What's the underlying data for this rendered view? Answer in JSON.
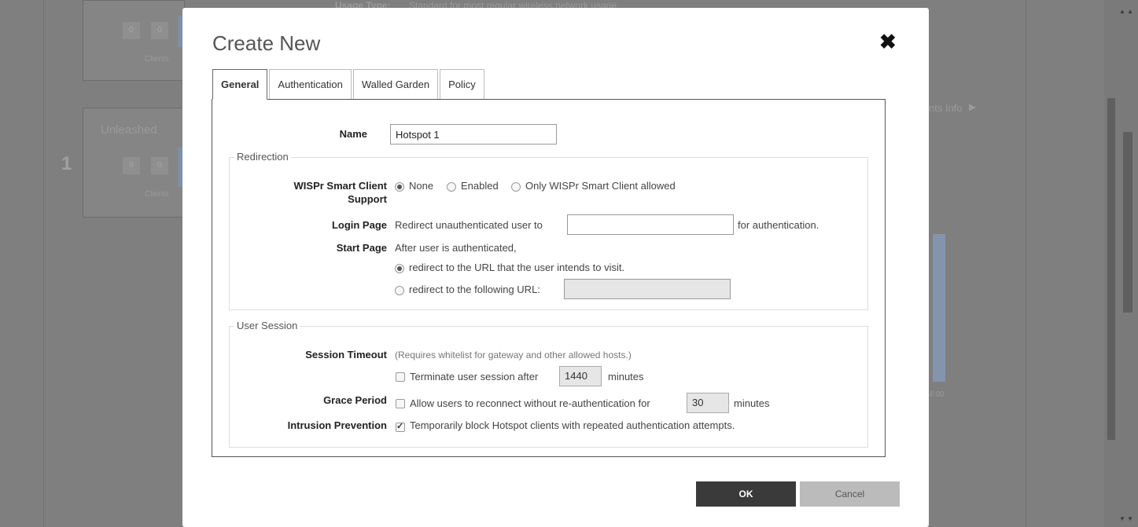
{
  "background": {
    "usage_type_label": "Usage Type:",
    "usage_type_value": "Standard for most regular wireless network usage",
    "card1": {
      "zero1": "0",
      "zero2": "0",
      "clients_label": "Clients"
    },
    "card2": {
      "title": "Unleashed",
      "count": "1",
      "zero1": "0",
      "zero2": "0",
      "clients_label": "Clients"
    },
    "clients_info_link": "nts Info",
    "chart_tick": "4:00"
  },
  "modal": {
    "title": "Create New",
    "close_icon": "close-icon",
    "tabs": [
      {
        "label": "General",
        "active": true
      },
      {
        "label": "Authentication",
        "active": false
      },
      {
        "label": "Walled Garden",
        "active": false
      },
      {
        "label": "Policy",
        "active": false
      }
    ],
    "general": {
      "name_label": "Name",
      "name_value": "Hotspot 1",
      "redirection": {
        "legend": "Redirection",
        "wispr_label_line1": "WISPr Smart Client",
        "wispr_label_line2": "Support",
        "wispr_options": [
          {
            "label": "None",
            "checked": true
          },
          {
            "label": "Enabled",
            "checked": false
          },
          {
            "label": "Only WISPr Smart Client allowed",
            "checked": false
          }
        ],
        "login_page_label": "Login Page",
        "login_page_prefix": "Redirect unauthenticated user to",
        "login_page_value": "",
        "login_page_suffix": "for authentication.",
        "start_page_label": "Start Page",
        "start_page_text": "After user is authenticated,",
        "start_option_intended": "redirect to the URL that the user intends to visit.",
        "start_option_following": "redirect to the following URL:",
        "start_option_intended_checked": true,
        "start_url_value": ""
      },
      "user_session": {
        "legend": "User Session",
        "session_timeout_label": "Session Timeout",
        "session_timeout_hint": "(Requires whitelist for gateway and other allowed hosts.)",
        "terminate_label": "Terminate user session after",
        "terminate_value": "1440",
        "terminate_unit": "minutes",
        "terminate_checked": false,
        "grace_period_label": "Grace Period",
        "grace_text": "Allow users to reconnect without re-authentication for",
        "grace_value": "30",
        "grace_unit": "minutes",
        "grace_checked": false,
        "intrusion_label": "Intrusion Prevention",
        "intrusion_text": "Temporarily block Hotspot clients with repeated authentication attempts.",
        "intrusion_checked": true
      }
    },
    "ok_label": "OK",
    "cancel_label": "Cancel"
  }
}
